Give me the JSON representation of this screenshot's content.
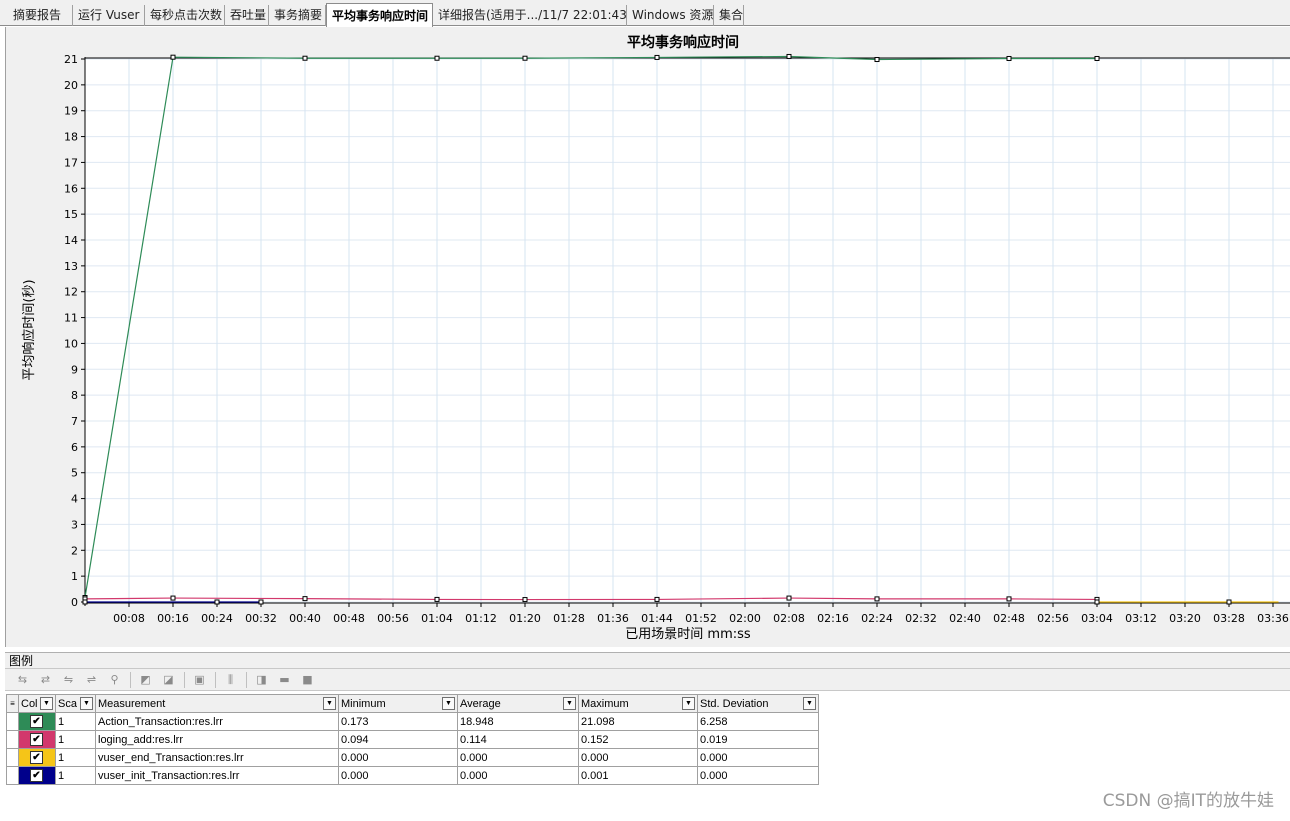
{
  "tabs": [
    {
      "label": "摘要报告",
      "active": false
    },
    {
      "label": "运行 Vuser",
      "active": false
    },
    {
      "label": "每秒点击次数",
      "active": false
    },
    {
      "label": "吞吐量",
      "active": false
    },
    {
      "label": "事务摘要",
      "active": false
    },
    {
      "label": "平均事务响应时间",
      "active": true
    },
    {
      "label": "详细报告(适用于.../11/7 22:01:43",
      "active": false
    },
    {
      "label": "Windows 资源",
      "active": false
    },
    {
      "label": "集合",
      "active": false
    }
  ],
  "legend_panel": {
    "title": "图例",
    "toolbar_icons": [
      "show-only-selected-icon",
      "show-all-icon",
      "hide-selected-icon",
      "hide-all-icon",
      "filter-icon",
      "sort-asc-icon",
      "sort-desc-icon",
      "configure-icon",
      "columns-icon",
      "animate-icon",
      "measurement-options-icon",
      "stop-icon"
    ],
    "columns": [
      "Col",
      "Sca",
      "Measurement",
      "Minimum",
      "Average",
      "Maximum",
      "Std. Deviation"
    ],
    "rows": [
      {
        "color": "#2e8b57",
        "checked": true,
        "scale": "1",
        "measurement": "Action_Transaction:res.lrr",
        "minimum": "0.173",
        "average": "18.948",
        "maximum": "21.098",
        "std_deviation": "6.258"
      },
      {
        "color": "#d2386c",
        "checked": true,
        "scale": "1",
        "measurement": "loging_add:res.lrr",
        "minimum": "0.094",
        "average": "0.114",
        "maximum": "0.152",
        "std_deviation": "0.019"
      },
      {
        "color": "#f5c518",
        "checked": true,
        "scale": "1",
        "measurement": "vuser_end_Transaction:res.lrr",
        "minimum": "0.000",
        "average": "0.000",
        "maximum": "0.000",
        "std_deviation": "0.000"
      },
      {
        "color": "#00008b",
        "checked": true,
        "scale": "1",
        "measurement": "vuser_init_Transaction:res.lrr",
        "minimum": "0.000",
        "average": "0.000",
        "maximum": "0.001",
        "std_deviation": "0.000"
      }
    ]
  },
  "watermark": "CSDN @搞IT的放牛娃",
  "chart_data": {
    "type": "line",
    "title": "平均事务响应时间",
    "xlabel": "已用场景时间 mm:ss",
    "ylabel": "平均响应时间(秒)",
    "xlim": [
      0,
      217
    ],
    "ylim": [
      0,
      21
    ],
    "x_tick_labels": [
      "00:08",
      "00:16",
      "00:24",
      "00:32",
      "00:40",
      "00:48",
      "00:56",
      "01:04",
      "01:12",
      "01:20",
      "01:28",
      "01:36",
      "01:44",
      "01:52",
      "02:00",
      "02:08",
      "02:16",
      "02:24",
      "02:32",
      "02:40",
      "02:48",
      "02:56",
      "03:04",
      "03:12",
      "03:20",
      "03:28",
      "03:36"
    ],
    "x_ticks_seconds": [
      8,
      16,
      24,
      32,
      40,
      48,
      56,
      64,
      72,
      80,
      88,
      96,
      104,
      112,
      120,
      128,
      136,
      144,
      152,
      160,
      168,
      176,
      184,
      192,
      200,
      208,
      216
    ],
    "y_ticks": [
      0,
      1,
      2,
      3,
      4,
      5,
      6,
      7,
      8,
      9,
      10,
      11,
      12,
      13,
      14,
      15,
      16,
      17,
      18,
      19,
      20,
      21
    ],
    "grid": true,
    "series": [
      {
        "name": "Action_Transaction:res.lrr",
        "color": "#2e8b57",
        "x": [
          0,
          16,
          40,
          64,
          80,
          104,
          128,
          144,
          168,
          184
        ],
        "y": [
          0.173,
          21.07,
          21.03,
          21.03,
          21.03,
          21.06,
          21.098,
          20.98,
          21.02,
          21.02
        ]
      },
      {
        "name": "loging_add:res.lrr",
        "color": "#d2386c",
        "x": [
          0,
          16,
          40,
          64,
          80,
          104,
          128,
          144,
          168,
          184
        ],
        "y": [
          0.12,
          0.152,
          0.13,
          0.1,
          0.094,
          0.1,
          0.152,
          0.12,
          0.12,
          0.1
        ]
      },
      {
        "name": "vuser_end_Transaction:res.lrr",
        "color": "#f5c518",
        "x": [
          184,
          208,
          217
        ],
        "y": [
          0.0,
          0.0,
          0.0
        ]
      },
      {
        "name": "vuser_init_Transaction:res.lrr",
        "color": "#00008b",
        "x": [
          0,
          24,
          32
        ],
        "y": [
          0.001,
          0.0,
          0.0
        ]
      }
    ]
  }
}
